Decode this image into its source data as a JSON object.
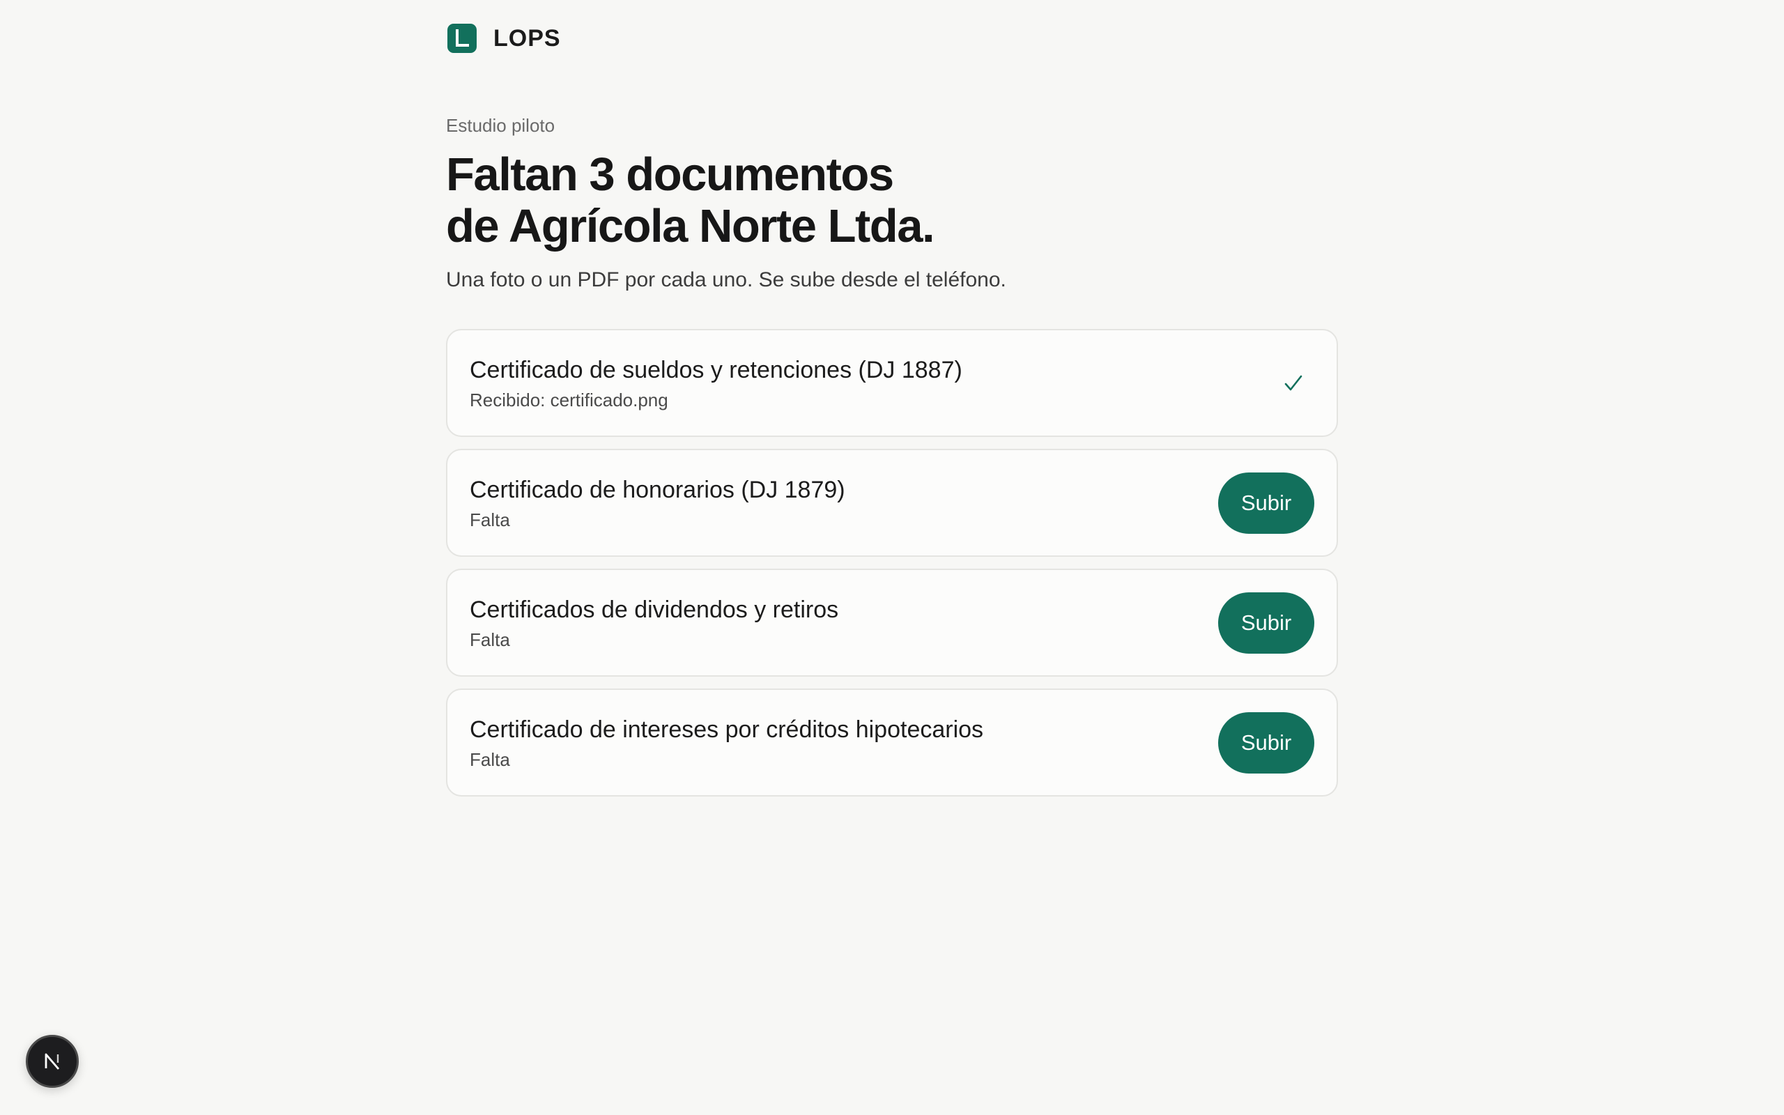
{
  "brand": {
    "name": "LOPS",
    "logo_letter": "L",
    "color": "#12705c"
  },
  "header": {
    "eyebrow": "Estudio piloto",
    "title_line1": "Faltan 3 documentos",
    "title_line2": "de Agrícola Norte Ltda.",
    "subtitle": "Una foto o un PDF por cada uno. Se sube desde el teléfono."
  },
  "documents": [
    {
      "name": "Certificado de sueldos y retenciones (DJ 1887)",
      "status": "Recibido: certificado.png",
      "received": true,
      "icon": "check-icon"
    },
    {
      "name": "Certificado de honorarios (DJ 1879)",
      "status": "Falta",
      "received": false,
      "button_label": "Subir"
    },
    {
      "name": "Certificados de dividendos y retiros",
      "status": "Falta",
      "received": false,
      "button_label": "Subir"
    },
    {
      "name": "Certificado de intereses por créditos hipotecarios",
      "status": "Falta",
      "received": false,
      "button_label": "Subir"
    }
  ],
  "dev_badge": {
    "letter": "N",
    "icon": "nextjs-icon"
  },
  "colors": {
    "accent": "#12705c",
    "background": "#f7f7f5",
    "card": "#fcfcfb"
  }
}
